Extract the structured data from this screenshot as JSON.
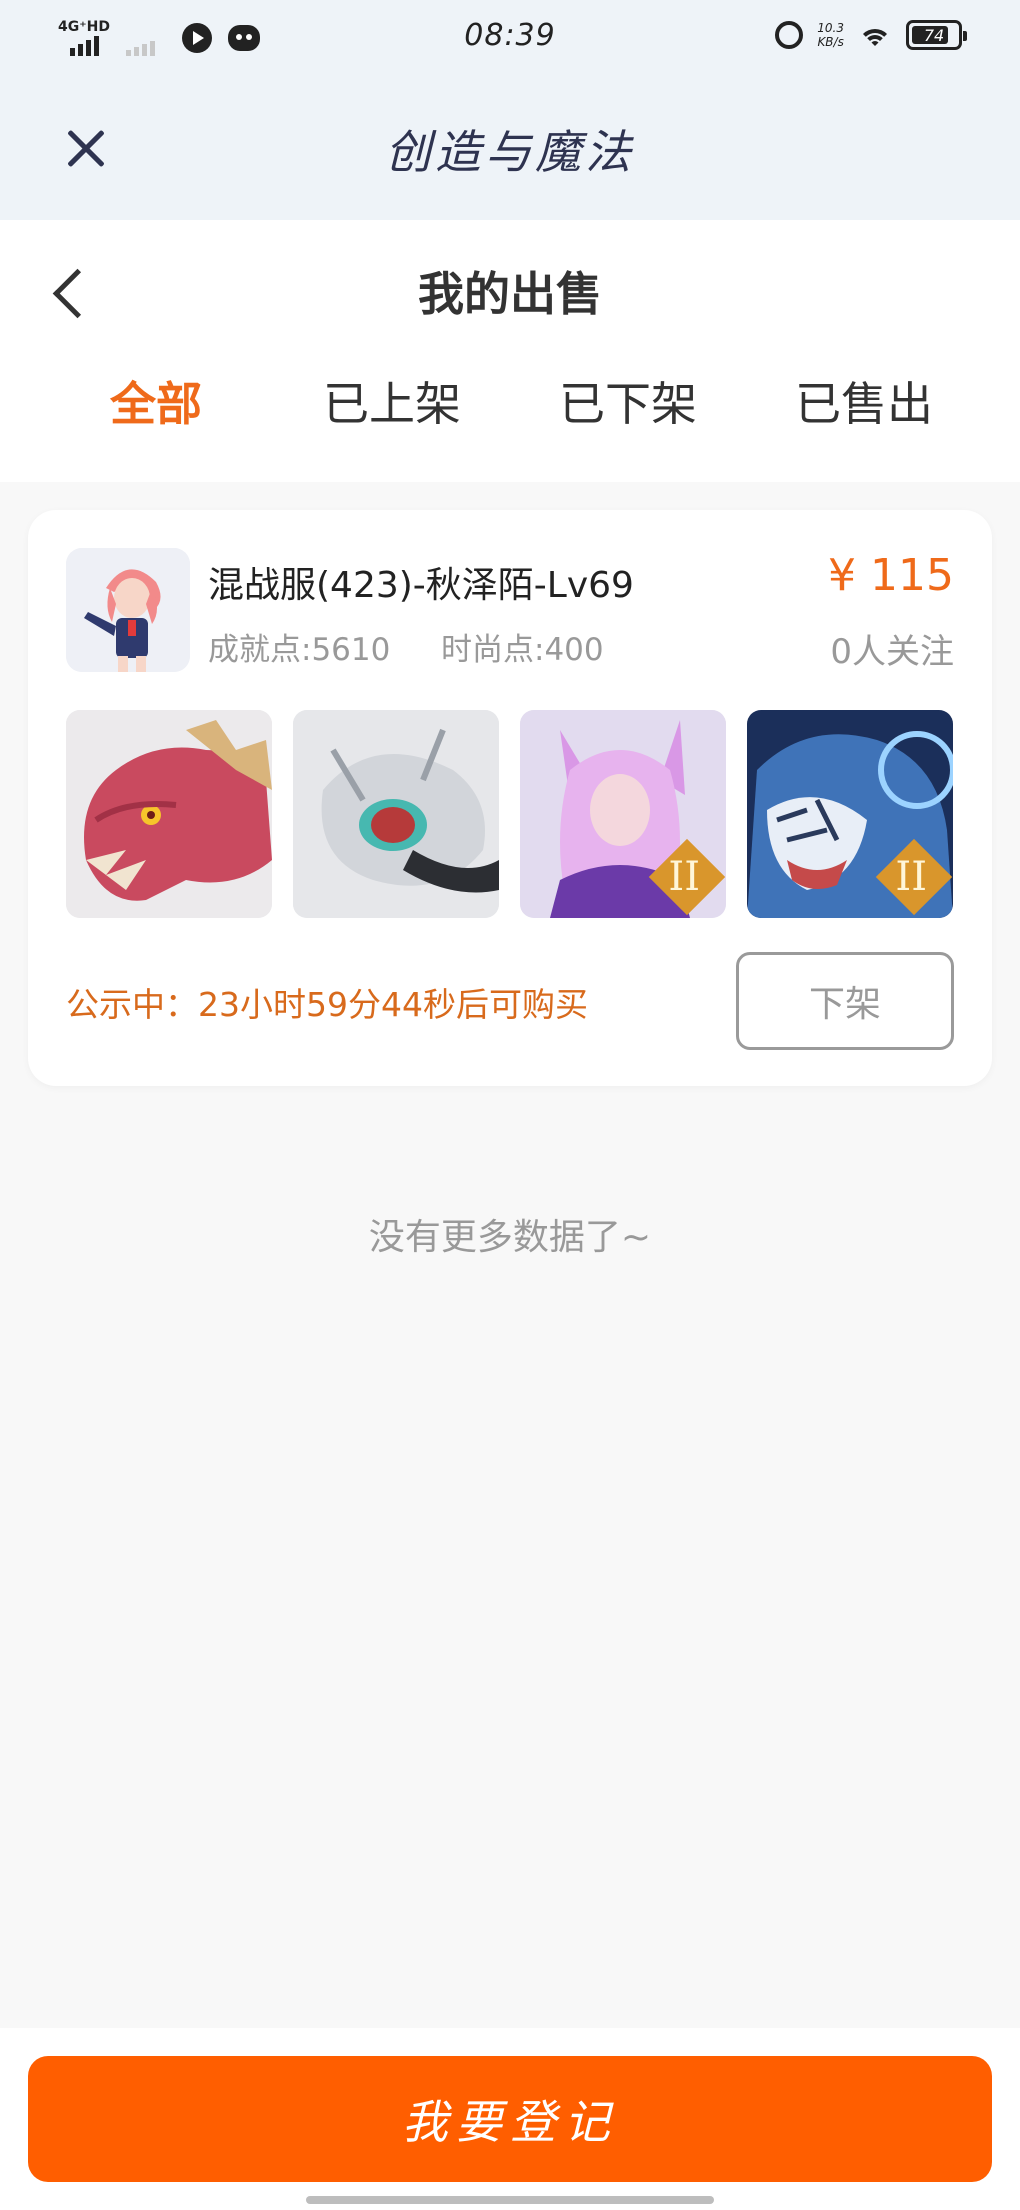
{
  "status_bar": {
    "network": "4G⁺HD",
    "time": "08:39",
    "speed_value": "10.3",
    "speed_unit": "KB/s",
    "battery": "74"
  },
  "app_header": {
    "title": "创造与魔法"
  },
  "page": {
    "title": "我的出售",
    "tabs": [
      {
        "label": "全部",
        "active": true
      },
      {
        "label": "已上架",
        "active": false
      },
      {
        "label": "已下架",
        "active": false
      },
      {
        "label": "已售出",
        "active": false
      }
    ]
  },
  "listing": {
    "title": "混战服(423)-秋泽陌-Lv69",
    "achievement": "成就点:5610",
    "fashion": "时尚点:400",
    "price": "¥ 115",
    "followers": "0人关注",
    "thumbnails": [
      {
        "name": "red-dragon-mount",
        "badge": ""
      },
      {
        "name": "silver-mech-mount",
        "badge": ""
      },
      {
        "name": "fox-spirit-outfit",
        "badge": "II"
      },
      {
        "name": "ice-tiger-mount",
        "badge": "II"
      }
    ],
    "notice": "公示中：23小时59分44秒后可购买",
    "delist_label": "下架"
  },
  "empty_hint": "没有更多数据了~",
  "bottom": {
    "register_label": "我要登记"
  },
  "colors": {
    "accent": "#ef6a1a",
    "button": "#ff5e00",
    "header_bg": "#eef3f8"
  }
}
